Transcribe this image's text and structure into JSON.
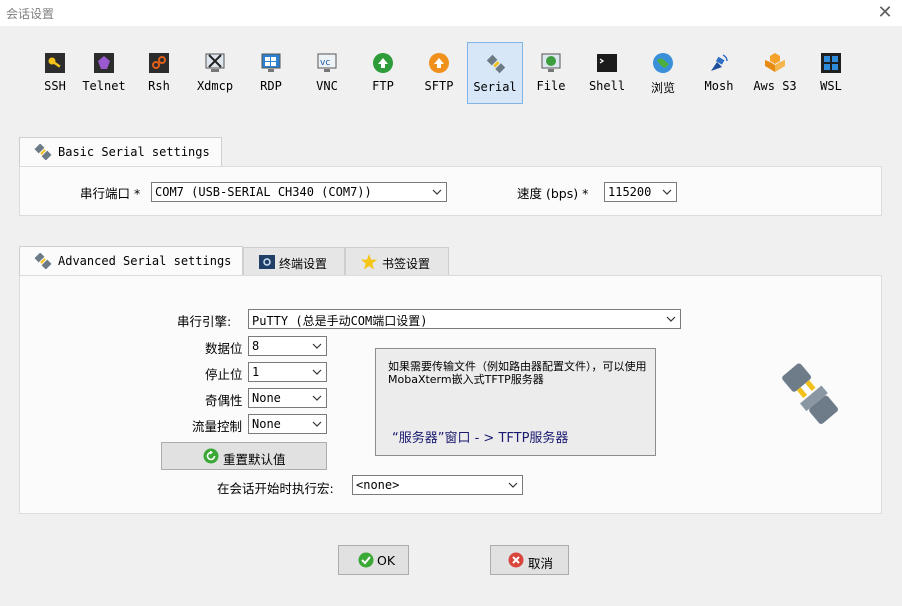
{
  "window": {
    "title": "会话设置",
    "close_glyph": "✕"
  },
  "toolbar": {
    "items": [
      {
        "label": "SSH",
        "icon": "key-icon"
      },
      {
        "label": "Telnet",
        "icon": "telnet-icon"
      },
      {
        "label": "Rsh",
        "icon": "rsh-icon"
      },
      {
        "label": "Xdmcp",
        "icon": "xdmcp-icon"
      },
      {
        "label": "RDP",
        "icon": "rdp-icon"
      },
      {
        "label": "VNC",
        "icon": "vnc-icon"
      },
      {
        "label": "FTP",
        "icon": "ftp-icon"
      },
      {
        "label": "SFTP",
        "icon": "sftp-icon"
      },
      {
        "label": "Serial",
        "icon": "serial-plug-icon",
        "selected": true
      },
      {
        "label": "File",
        "icon": "file-icon"
      },
      {
        "label": "Shell",
        "icon": "shell-icon"
      },
      {
        "label": "浏览",
        "icon": "browser-globe-icon"
      },
      {
        "label": "Mosh",
        "icon": "mosh-icon"
      },
      {
        "label": "Aws S3",
        "icon": "aws-s3-icon"
      },
      {
        "label": "WSL",
        "icon": "wsl-icon"
      }
    ]
  },
  "basic": {
    "tab_label": "Basic Serial settings",
    "port_label": "串行端口 *",
    "port_value": "COM7  (USB-SERIAL CH340 (COM7))",
    "speed_label": "速度 (bps) *",
    "speed_value": "115200"
  },
  "advanced": {
    "tabs": [
      {
        "label": "Advanced Serial settings"
      },
      {
        "label": "终端设置"
      },
      {
        "label": "书签设置"
      }
    ],
    "engine_label": "串行引擎:",
    "engine_value": "PuTTY    (总是手动COM端口设置)",
    "databits_label": "数据位",
    "databits_value": "8",
    "stopbits_label": "停止位",
    "stopbits_value": "1",
    "parity_label": "奇偶性",
    "parity_value": "None",
    "flow_label": "流量控制",
    "flow_value": "None",
    "reset_label": "重置默认值",
    "macro_label": "在会话开始时执行宏:",
    "macro_value": "<none>",
    "info_text": "如果需要传输文件（例如路由器配置文件），可以使用MobaXterm嵌入式TFTP服务器",
    "info_link": "“服务器”窗口 - > TFTP服务器"
  },
  "footer": {
    "ok_label": "OK",
    "cancel_label": "取消"
  },
  "colors": {
    "selected_bg": "#d7e7f7",
    "selected_border": "#7fb4e4",
    "ok_green": "#3aa935",
    "cancel_red": "#d9453b"
  }
}
